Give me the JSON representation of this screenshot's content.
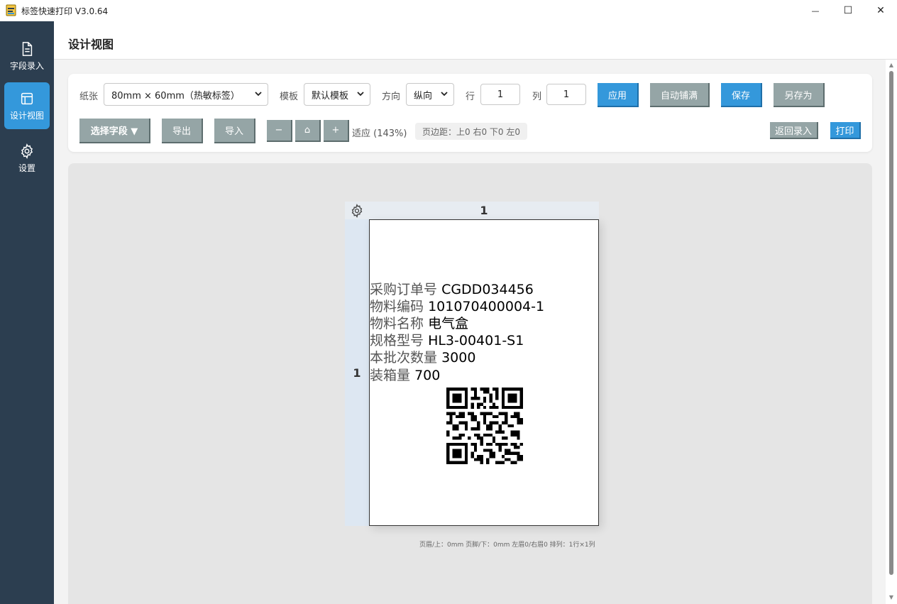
{
  "window": {
    "title": "标签快速打印 V3.0.64",
    "minimize": "—",
    "maximize": "☐",
    "close": "✕"
  },
  "sidebar": {
    "items": [
      {
        "label": "字段录入",
        "icon": "document-icon",
        "active": false
      },
      {
        "label": "设计视图",
        "icon": "layout-icon",
        "active": true
      },
      {
        "label": "设置",
        "icon": "gear-icon",
        "active": false
      }
    ]
  },
  "header": {
    "title": "设计视图"
  },
  "toolbar": {
    "paper_label": "纸张",
    "paper_value": "80mm × 60mm（热敏标签）",
    "template_label": "模板",
    "template_value": "默认模板",
    "orientation_label": "方向",
    "orientation_value": "纵向",
    "rows_label": "行",
    "rows_value": "1",
    "cols_label": "列",
    "cols_value": "1",
    "apply": "应用",
    "auto_fill": "自动铺满",
    "save": "保存",
    "save_as": "另存为",
    "select_field": "选择字段 ▼",
    "export": "导出",
    "import": "导入",
    "zoom_out": "−",
    "zoom_home": "⌂",
    "zoom_in": "+",
    "zoom_text": "适应 (143%)",
    "margins_info": "页边距：上0 右0 下0 左0",
    "back_to_entry": "返回录入",
    "print": "打印"
  },
  "canvas": {
    "col_header": "1",
    "row_header": "1",
    "fields": [
      {
        "name": "采购订单号",
        "value": "CGDD034456"
      },
      {
        "name": "物料编码",
        "value": "101070400004-1"
      },
      {
        "name": "物料名称",
        "value": "电气盒"
      },
      {
        "name": "规格型号",
        "value": "HL3-00401-S1"
      },
      {
        "name": "本批次数量",
        "value": "3000"
      },
      {
        "name": "装箱量",
        "value": "700"
      }
    ],
    "status": "页眉/上：0mm 页脚/下：0mm 左眉0/右眉0 排列：1行×1列"
  },
  "colors": {
    "sidebar_bg": "#2c3e50",
    "accent": "#3498db",
    "gray_button": "#95a5a6"
  }
}
